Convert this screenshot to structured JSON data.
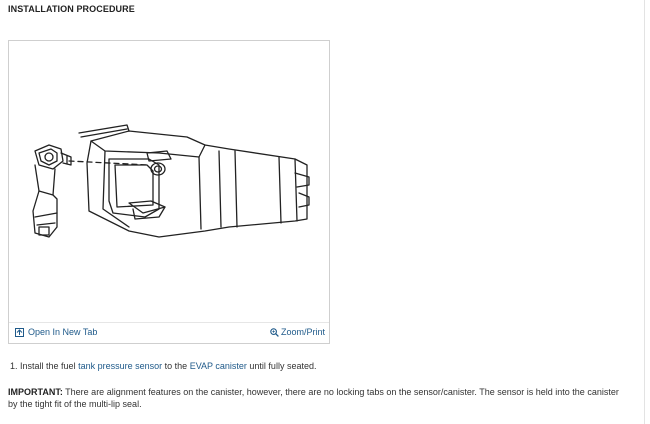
{
  "heading": "INSTALLATION PROCEDURE",
  "figure": {
    "open_new_tab_label": "Open In New Tab",
    "zoom_print_label": "Zoom/Print"
  },
  "step": {
    "number": "1.",
    "text_before": "Install the fuel",
    "link1": "tank pressure sensor",
    "text_middle": "to the",
    "link2": "EVAP canister",
    "text_after": "until fully seated."
  },
  "important": {
    "label": "IMPORTANT:",
    "text": "There are alignment features on the canister, however, there are no locking tabs on the sensor/canister. The sensor is held into the canister by the tight fit of the multi-lip seal."
  },
  "colors": {
    "link": "#1f5a8a",
    "border": "#cfcfcf"
  }
}
